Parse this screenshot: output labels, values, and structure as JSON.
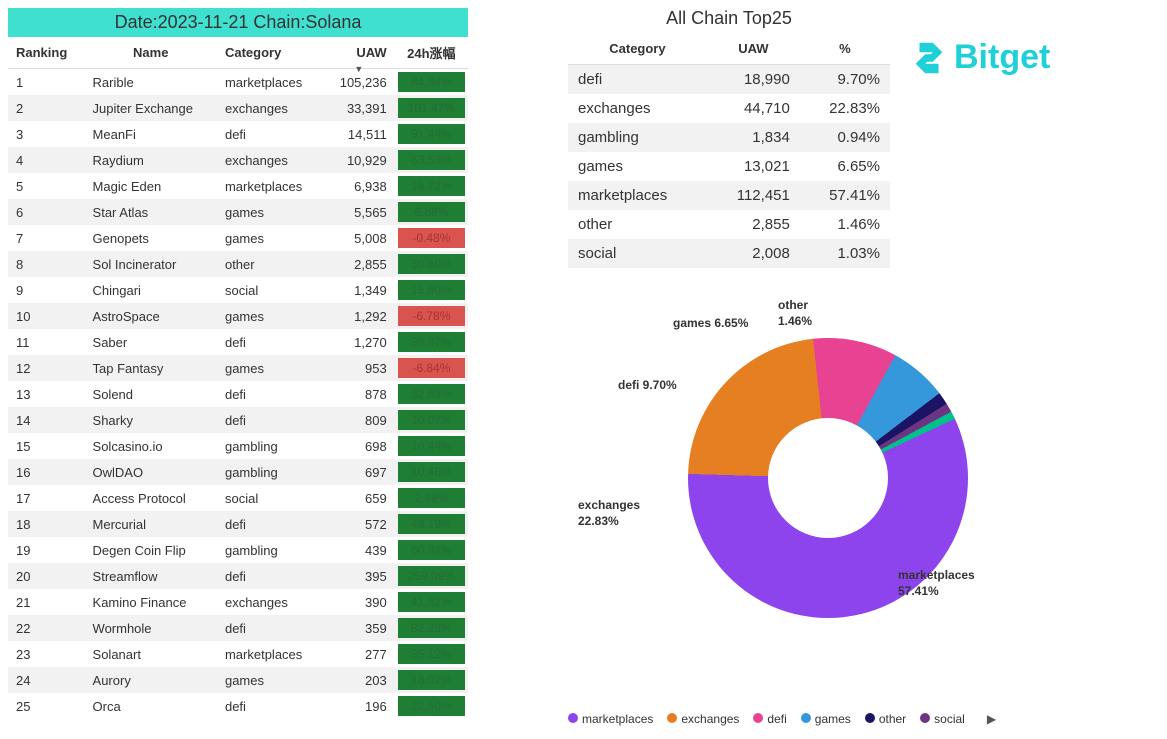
{
  "header": {
    "title": "Date:2023-11-21 Chain:Solana"
  },
  "ranking": {
    "columns": {
      "rank": "Ranking",
      "name": "Name",
      "category": "Category",
      "uaw": "UAW",
      "chg": "24h涨幅"
    },
    "rows": [
      {
        "rank": "1",
        "name": "Rarible",
        "category": "marketplaces",
        "uaw": "105,236",
        "chg": "84.84%",
        "dir": "pos"
      },
      {
        "rank": "2",
        "name": "Jupiter Exchange",
        "category": "exchanges",
        "uaw": "33,391",
        "chg": "101.47%",
        "dir": "pos"
      },
      {
        "rank": "3",
        "name": "MeanFi",
        "category": "defi",
        "uaw": "14,511",
        "chg": "91.44%",
        "dir": "pos"
      },
      {
        "rank": "4",
        "name": "Raydium",
        "category": "exchanges",
        "uaw": "10,929",
        "chg": "63.53%",
        "dir": "pos"
      },
      {
        "rank": "5",
        "name": "Magic Eden",
        "category": "marketplaces",
        "uaw": "6,938",
        "chg": "16.72%",
        "dir": "pos"
      },
      {
        "rank": "6",
        "name": "Star Atlas",
        "category": "games",
        "uaw": "5,565",
        "chg": "6.88%",
        "dir": "pos"
      },
      {
        "rank": "7",
        "name": "Genopets",
        "category": "games",
        "uaw": "5,008",
        "chg": "-0.48%",
        "dir": "neg"
      },
      {
        "rank": "8",
        "name": "Sol Incinerator",
        "category": "other",
        "uaw": "2,855",
        "chg": "30.60%",
        "dir": "pos"
      },
      {
        "rank": "9",
        "name": "Chingari",
        "category": "social",
        "uaw": "1,349",
        "chg": "15.60%",
        "dir": "pos"
      },
      {
        "rank": "10",
        "name": "AstroSpace",
        "category": "games",
        "uaw": "1,292",
        "chg": "-6.78%",
        "dir": "neg"
      },
      {
        "rank": "11",
        "name": "Saber",
        "category": "defi",
        "uaw": "1,270",
        "chg": "39.87%",
        "dir": "pos"
      },
      {
        "rank": "12",
        "name": "Tap Fantasy",
        "category": "games",
        "uaw": "953",
        "chg": "-6.84%",
        "dir": "neg"
      },
      {
        "rank": "13",
        "name": "Solend",
        "category": "defi",
        "uaw": "878",
        "chg": "32.63%",
        "dir": "pos"
      },
      {
        "rank": "14",
        "name": "Sharky",
        "category": "defi",
        "uaw": "809",
        "chg": "10.07%",
        "dir": "pos"
      },
      {
        "rank": "15",
        "name": "Solcasino.io",
        "category": "gambling",
        "uaw": "698",
        "chg": "10.44%",
        "dir": "pos"
      },
      {
        "rank": "16",
        "name": "OwlDAO",
        "category": "gambling",
        "uaw": "697",
        "chg": "10.46%",
        "dir": "pos"
      },
      {
        "rank": "17",
        "name": "Access Protocol",
        "category": "social",
        "uaw": "659",
        "chg": "2.49%",
        "dir": "pos"
      },
      {
        "rank": "18",
        "name": "Mercurial",
        "category": "defi",
        "uaw": "572",
        "chg": "48.19%",
        "dir": "pos"
      },
      {
        "rank": "19",
        "name": "Degen Coin Flip",
        "category": "gambling",
        "uaw": "439",
        "chg": "60.81%",
        "dir": "pos"
      },
      {
        "rank": "20",
        "name": "Streamflow",
        "category": "defi",
        "uaw": "395",
        "chg": "259.09%",
        "dir": "pos"
      },
      {
        "rank": "21",
        "name": "Kamino Finance",
        "category": "exchanges",
        "uaw": "390",
        "chg": "41.82%",
        "dir": "pos"
      },
      {
        "rank": "22",
        "name": "Wormhole",
        "category": "defi",
        "uaw": "359",
        "chg": "82.23%",
        "dir": "pos"
      },
      {
        "rank": "23",
        "name": "Solanart",
        "category": "marketplaces",
        "uaw": "277",
        "chg": "35.12%",
        "dir": "pos"
      },
      {
        "rank": "24",
        "name": "Aurory",
        "category": "games",
        "uaw": "203",
        "chg": "18.02%",
        "dir": "pos"
      },
      {
        "rank": "25",
        "name": "Orca",
        "category": "defi",
        "uaw": "196",
        "chg": "22.50%",
        "dir": "pos"
      }
    ]
  },
  "top25": {
    "title": "All Chain Top25",
    "columns": {
      "category": "Category",
      "uaw": "UAW",
      "pct": "%"
    },
    "rows": [
      {
        "category": "defi",
        "uaw": "18,990",
        "pct": "9.70%"
      },
      {
        "category": "exchanges",
        "uaw": "44,710",
        "pct": "22.83%"
      },
      {
        "category": "gambling",
        "uaw": "1,834",
        "pct": "0.94%"
      },
      {
        "category": "games",
        "uaw": "13,021",
        "pct": "6.65%"
      },
      {
        "category": "marketplaces",
        "uaw": "112,451",
        "pct": "57.41%"
      },
      {
        "category": "other",
        "uaw": "2,855",
        "pct": "1.46%"
      },
      {
        "category": "social",
        "uaw": "2,008",
        "pct": "1.03%"
      }
    ]
  },
  "brand": {
    "name": "Bitget"
  },
  "chart_data": {
    "type": "pie",
    "title": "",
    "series": [
      {
        "name": "marketplaces",
        "value": 57.41,
        "color": "#8e44ec"
      },
      {
        "name": "exchanges",
        "value": 22.83,
        "color": "#e67e22"
      },
      {
        "name": "defi",
        "value": 9.7,
        "color": "#e84393"
      },
      {
        "name": "games",
        "value": 6.65,
        "color": "#3498db"
      },
      {
        "name": "other",
        "value": 1.46,
        "color": "#1b1464"
      },
      {
        "name": "social",
        "value": 1.03,
        "color": "#6c3483"
      },
      {
        "name": "gambling",
        "value": 0.94,
        "color": "#00c08b"
      }
    ],
    "labels": {
      "marketplaces": "marketplaces\n57.41%",
      "exchanges": "exchanges\n22.83%",
      "defi": "defi 9.70%",
      "games": "games 6.65%",
      "other": "other\n1.46%"
    },
    "legend": [
      "marketplaces",
      "exchanges",
      "defi",
      "games",
      "other",
      "social"
    ]
  }
}
